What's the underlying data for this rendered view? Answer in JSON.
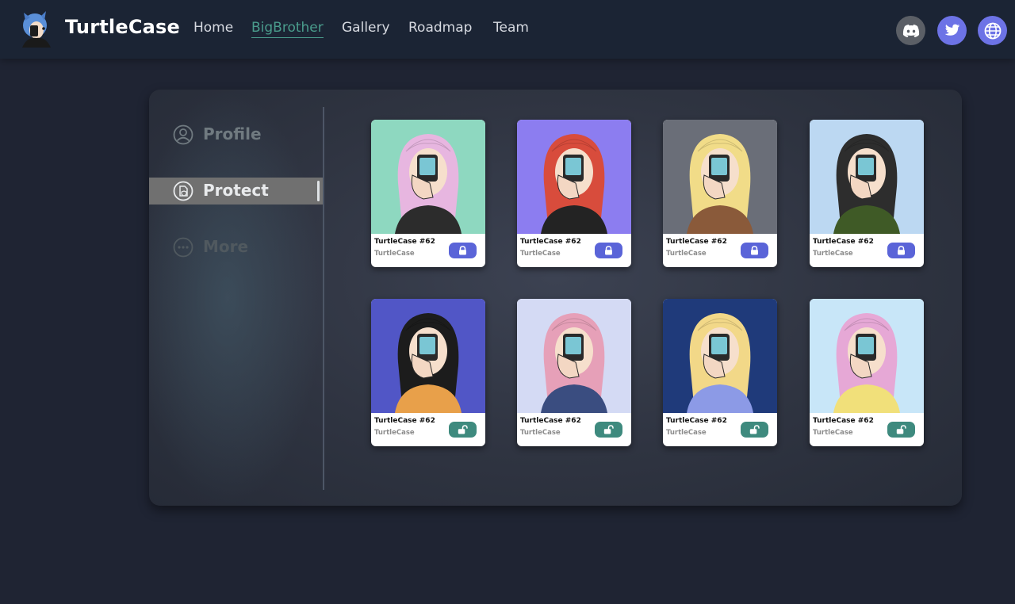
{
  "header": {
    "brand": "TurtleCase",
    "nav": [
      {
        "label": "Home",
        "active": false
      },
      {
        "label": "BigBrother",
        "active": true
      },
      {
        "label": "Gallery",
        "active": false
      },
      {
        "label": "Roadmap",
        "active": false
      },
      {
        "label": "Team",
        "active": false
      }
    ],
    "social": [
      {
        "icon": "discord-icon",
        "color": "#5b5f66"
      },
      {
        "icon": "twitter-icon",
        "color": "#6d73e6"
      },
      {
        "icon": "globe-icon",
        "color": "#6d73e6"
      }
    ]
  },
  "sidebar": {
    "items": [
      {
        "label": "Profile",
        "icon": "user-circle-icon",
        "active": false
      },
      {
        "label": "Protect",
        "icon": "shield-document-icon",
        "active": true
      },
      {
        "label": "More",
        "icon": "more-dots-icon",
        "active": false
      }
    ]
  },
  "cards": [
    {
      "name": "TurtleCase #62",
      "collection": "TurtleCase",
      "status": "locked",
      "bg": "#8ed8c0",
      "hair": "#e7b6e0",
      "outfit": "#2c2c2c"
    },
    {
      "name": "TurtleCase #62",
      "collection": "TurtleCase",
      "status": "locked",
      "bg": "#8c7df0",
      "hair": "#d84c3c",
      "outfit": "#232323"
    },
    {
      "name": "TurtleCase #62",
      "collection": "TurtleCase",
      "status": "locked",
      "bg": "#6a6e78",
      "hair": "#f1dc88",
      "outfit": "#8a5a3a"
    },
    {
      "name": "TurtleCase #62",
      "collection": "TurtleCase",
      "status": "locked",
      "bg": "#bcd8f2",
      "hair": "#2d2d2d",
      "outfit": "#3f5a26"
    },
    {
      "name": "TurtleCase #62",
      "collection": "TurtleCase",
      "status": "unlocked",
      "bg": "#5156c6",
      "hair": "#1c1c1c",
      "outfit": "#e8a04a"
    },
    {
      "name": "TurtleCase #62",
      "collection": "TurtleCase",
      "status": "unlocked",
      "bg": "#d4daf4",
      "hair": "#e6a0b8",
      "outfit": "#3a4d80"
    },
    {
      "name": "TurtleCase #62",
      "collection": "TurtleCase",
      "status": "unlocked",
      "bg": "#1f3a7a",
      "hair": "#f2d888",
      "outfit": "#8c9ae6"
    },
    {
      "name": "TurtleCase #62",
      "collection": "TurtleCase",
      "status": "unlocked",
      "bg": "#c8e6f8",
      "hair": "#e6a8d6",
      "outfit": "#f1e07a"
    }
  ]
}
